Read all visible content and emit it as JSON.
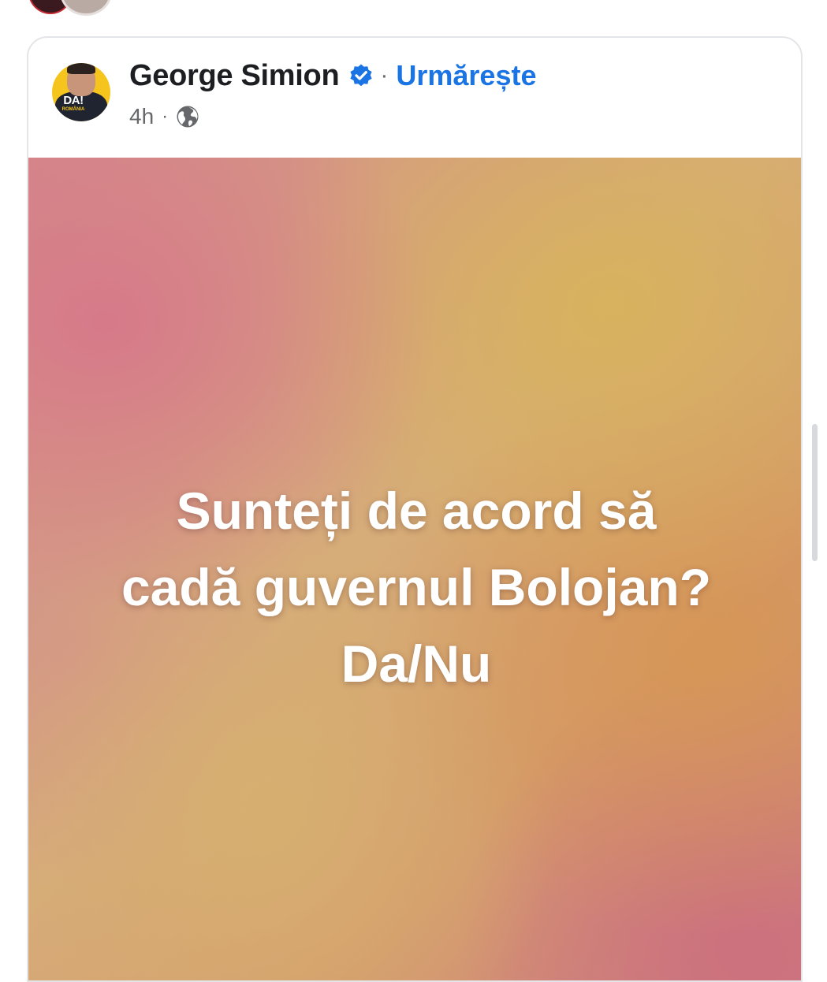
{
  "post": {
    "author": {
      "name": "George Simion",
      "avatar_logo": "DA!",
      "avatar_logo_sub": "ROMÂNIA"
    },
    "follow_label": "Urmărește",
    "dot_separator": "·",
    "time": "4h",
    "time_separator": "·",
    "privacy_icon": "globe-icon",
    "verified_icon": "verified-badge-icon",
    "text_lines": [
      "Sunteți de acord să",
      "cadă guvernul Bolojan?",
      "Da/Nu"
    ]
  },
  "colors": {
    "follow_link": "#1b74e4",
    "verified_badge": "#1b74e4",
    "name_text": "#1c1e21",
    "meta_text": "#65676b"
  }
}
